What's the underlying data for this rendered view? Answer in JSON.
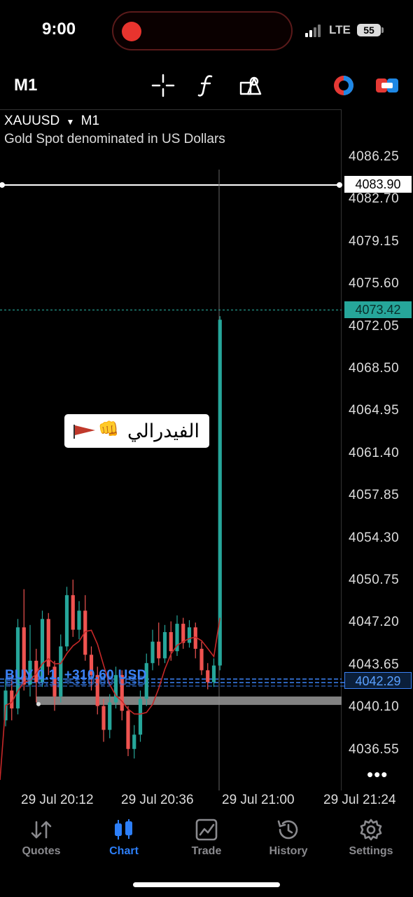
{
  "status_bar": {
    "time": "9:00",
    "network": "LTE",
    "battery": "55"
  },
  "toolbar": {
    "timeframe": "M1"
  },
  "chart": {
    "symbol": "XAUUSD",
    "symbol_timeframe": "M1",
    "description": "Gold Spot denominated in US Dollars",
    "price_axis": [
      "4086.25",
      "4082.70",
      "4079.15",
      "4075.60",
      "4072.05",
      "4068.50",
      "4064.95",
      "4061.40",
      "4057.85",
      "4054.30",
      "4050.75",
      "4047.20",
      "4043.65",
      "4040.10",
      "4036.55"
    ],
    "crosshair_price": "4083.90",
    "bid_price": "4073.42",
    "position_price": "4042.29",
    "time_axis": [
      "29 Jul 20:12",
      "29 Jul 20:36",
      "29 Jul 21:00",
      "29 Jul 21:24"
    ],
    "annotation_text": "الفيدرالي",
    "position_label": "BUY 0.1, +310.60 USD",
    "position_label_ghost": "BUY 0.1, +310.60 USD",
    "colors": {
      "bull": "#26a69a",
      "bear": "#ef5350",
      "ma": "#c62828",
      "position": "#3b82f6",
      "bid": "#26a69a"
    }
  },
  "nav": {
    "quotes": "Quotes",
    "chart": "Chart",
    "trade": "Trade",
    "history": "History",
    "settings": "Settings"
  }
}
